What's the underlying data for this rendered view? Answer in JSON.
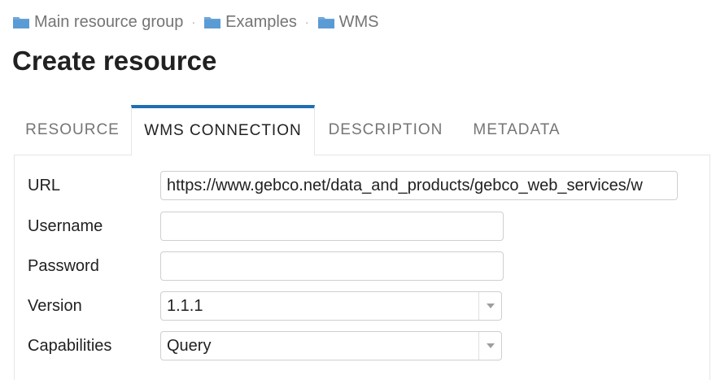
{
  "breadcrumb": {
    "items": [
      "Main resource group",
      "Examples",
      "WMS"
    ],
    "separator": "·"
  },
  "title": "Create resource",
  "tabs": [
    {
      "label": "Resource",
      "active": false
    },
    {
      "label": "WMS connection",
      "active": true
    },
    {
      "label": "Description",
      "active": false
    },
    {
      "label": "Metadata",
      "active": false
    }
  ],
  "form": {
    "url": {
      "label": "URL",
      "value": "https://www.gebco.net/data_and_products/gebco_web_services/w"
    },
    "username": {
      "label": "Username",
      "value": ""
    },
    "password": {
      "label": "Password",
      "value": ""
    },
    "version": {
      "label": "Version",
      "value": "1.1.1"
    },
    "capabilities": {
      "label": "Capabilities",
      "value": "Query"
    }
  },
  "colors": {
    "accent": "#1e6fb1",
    "folder": "#5b9bd5"
  }
}
